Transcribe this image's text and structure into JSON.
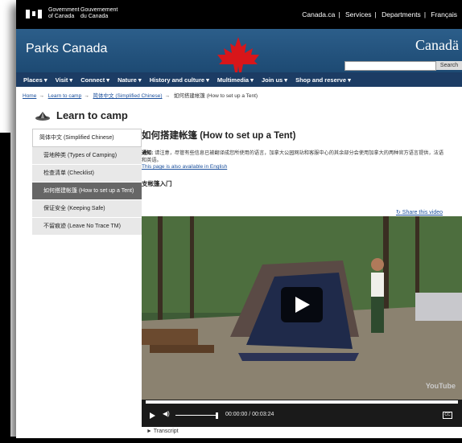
{
  "gov": {
    "en": "Government\nof Canada",
    "fr": "Gouvernement\ndu Canada",
    "links": [
      "Canada.ca",
      "Services",
      "Departments",
      "Français"
    ]
  },
  "banner": {
    "site_title": "Parks Canada",
    "wordmark": "Canadä",
    "search_button": "Search"
  },
  "nav": [
    "Places",
    "Visit",
    "Connect",
    "Nature",
    "History and culture",
    "Multimedia",
    "Join us",
    "Shop and reserve"
  ],
  "breadcrumb": [
    "Home",
    "Learn to camp",
    "简体中文 (Simplified Chinese)",
    "如何搭建帐篷 (How to set up a Tent)"
  ],
  "section_heading": "Learn to camp",
  "sidebar": [
    "简体中文 (Simplified Chinese)",
    "营地种类 (Types of Camping)",
    "检查清单 (Checklist)",
    "如何搭建帐篷 (How to set up a Tent)",
    "保证安全 (Keeping Safe)",
    "不留痕迹 (Leave No Trace TM)"
  ],
  "main": {
    "title": "如何搭建帐篷 (How to set up a Tent)",
    "notice_label": "通知:",
    "notice_text": "请注意，尽管有些信息已被翻译成您所使用的语言，加拿大公园网站和客服中心的其余部分会使用加拿大的两种官方语言提供，法语和英语。",
    "english_link": "This page is also available in English",
    "video_heading": "支帐篷入门",
    "share": "Share this video"
  },
  "video": {
    "current_time": "00:00:00",
    "separator": "/",
    "duration": "00:03:24",
    "watermark": "YouTube",
    "progress_fraction": 0
  },
  "transcript": "Transcript",
  "colors": {
    "banner": "#1d4a73",
    "nav": "#1c3c64",
    "leaf": "#d8161a",
    "link": "#1a4f9c"
  }
}
